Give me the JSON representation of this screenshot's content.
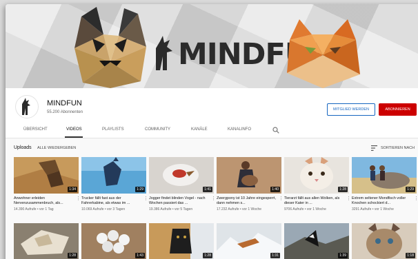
{
  "channel": {
    "banner_text": "MINDFUN",
    "name": "MINDFUN",
    "subscribers": "55.200 Abonnenten",
    "join_label": "MITGLIED WERDEN",
    "subscribe_label": "ABONNIEREN",
    "accent_red": "#cc0000",
    "accent_blue": "#1565c0"
  },
  "tabs": [
    {
      "label": "ÜBERSICHT"
    },
    {
      "label": "VIDEOS",
      "active": true
    },
    {
      "label": "PLAYLISTS"
    },
    {
      "label": "COMMUNITY"
    },
    {
      "label": "KANÄLE"
    },
    {
      "label": "KANALINFO"
    }
  ],
  "uploads": {
    "label": "Uploads",
    "play_all": "ALLE WIEDERGEBEN",
    "sort_label": "SORTIEREN NACH"
  },
  "videos": [
    {
      "title": "Anwohner erleiden Nervenzusammenbruch, als...",
      "meta": "14.390 Aufrufe • vor 1 Tag",
      "duration": "1:34"
    },
    {
      "title": "Trucker fällt fast aus der Fahrerkabine, als etwas im ...",
      "meta": "10.069 Aufrufe • vor 3 Tagen",
      "duration": "1:29"
    },
    {
      "title": "Jogger findet blinden Vogel - nach Wochen passiert das ...",
      "meta": "19.386 Aufrufe • vor 5 Tagen",
      "duration": "1:41"
    },
    {
      "title": "Zwergpony ist 10 Jahre eingesperrt, dann nehmen s...",
      "meta": "17.232 Aufrufe • vor 1 Woche",
      "duration": "1:40"
    },
    {
      "title": "Tierarzt fällt aus allen Wolken, als dieser Kater in ...",
      "meta": "9706 Aufrufe • vor 1 Woche",
      "duration": "1:28"
    },
    {
      "title": "Extrem seltener Mondfisch voller Knochen schockiert d...",
      "meta": "3291 Aufrufe • vor 1 Woche",
      "duration": "1:29"
    },
    {
      "title": "",
      "meta": "",
      "duration": "1:28"
    },
    {
      "title": "",
      "meta": "",
      "duration": "1:43"
    },
    {
      "title": "",
      "meta": "",
      "duration": "1:28"
    },
    {
      "title": "",
      "meta": "",
      "duration": "1:31"
    },
    {
      "title": "",
      "meta": "",
      "duration": "1:39"
    },
    {
      "title": "",
      "meta": "",
      "duration": "1:18"
    }
  ],
  "icons": {
    "search": "search-icon",
    "sort": "sort-icon",
    "menu": "more-vertical-icon"
  }
}
